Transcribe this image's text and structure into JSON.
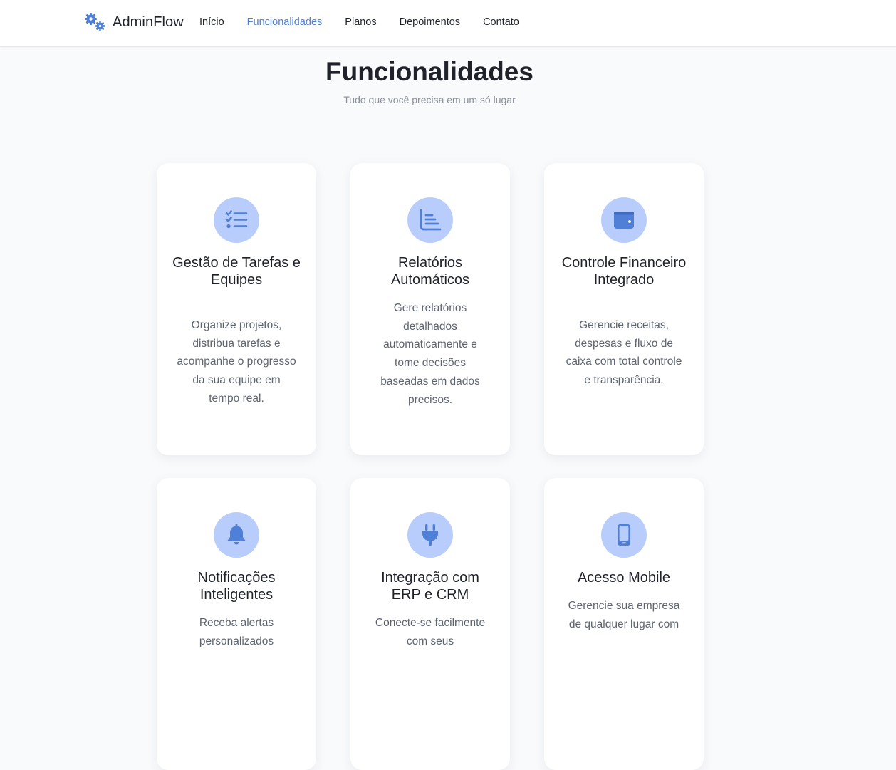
{
  "brand": {
    "name": "AdminFlow",
    "icon": "gears-icon",
    "accent": "#4f7fd6"
  },
  "nav": {
    "items": [
      {
        "label": "Início"
      },
      {
        "label": "Funcionalidades",
        "active": true
      },
      {
        "label": "Planos"
      },
      {
        "label": "Depoimentos"
      },
      {
        "label": "Contato"
      }
    ]
  },
  "section": {
    "title": "Funcionalidades",
    "subtitle": "Tudo que você precisa em um só lugar"
  },
  "features": [
    {
      "icon": "task-list-icon",
      "title": "Gestão de Tarefas e Equipes",
      "text": "Organize projetos, distribua tarefas e acompanhe o progresso da sua equipe em tempo real."
    },
    {
      "icon": "chart-icon",
      "title": "Relatórios Automáticos",
      "text": "Gere relatórios detalhados automaticamente e tome decisões baseadas em dados precisos."
    },
    {
      "icon": "wallet-icon",
      "title": "Controle Financeiro Integrado",
      "text": "Gerencie receitas, despesas e fluxo de caixa com total controle e transparência."
    },
    {
      "icon": "bell-icon",
      "title": "Notificações Inteligentes",
      "text": "Receba alertas personalizados"
    },
    {
      "icon": "plug-icon",
      "title": "Integração com ERP e CRM",
      "text": "Conecte-se facilmente com seus"
    },
    {
      "icon": "mobile-icon",
      "title": "Acesso Mobile",
      "text": "Gerencie sua empresa de qualquer lugar com"
    }
  ],
  "colors": {
    "icon_bg": "#b8cdfb",
    "icon_fg": "#4f7fd6",
    "card_bg": "#ffffff",
    "page_bg": "#f9fafc"
  }
}
